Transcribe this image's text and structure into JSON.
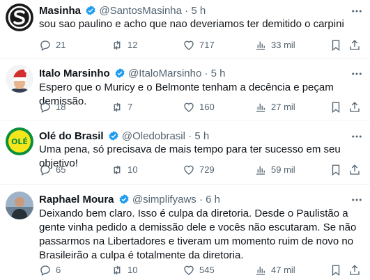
{
  "colors": {
    "text": "#0f1419",
    "secondary": "#536471",
    "verified": "#1d9bf0",
    "divider": "#eff3f4"
  },
  "tweets": [
    {
      "name": "Masinha",
      "handle": "@SantosMasinha",
      "separator": "·",
      "time": "5 h",
      "text": "sou sao paulino e acho que nao deveriamos ter demitido o carpini",
      "replies": "21",
      "retweets": "12",
      "likes": "717",
      "views": "33 mil",
      "avatar_icon": "masinha-logo-icon"
    },
    {
      "name": "Italo Marsinho",
      "handle": "@ItaloMarsinho",
      "separator": "·",
      "time": "5 h",
      "text": "Espero que o Muricy e o Belmonte tenham a decência e peçam demissão.",
      "replies": "18",
      "retweets": "7",
      "likes": "160",
      "views": "27 mil",
      "avatar_icon": "santa-hat-avatar-icon"
    },
    {
      "name": "Olé do Brasil",
      "handle": "@Oledobrasil",
      "separator": "·",
      "time": "5 h",
      "text": "Uma pena, só precisava de mais tempo para ter sucesso em seu objetivo!",
      "replies": "65",
      "retweets": "10",
      "likes": "729",
      "views": "59 mil",
      "avatar_icon": "ole-logo-icon",
      "avatar_logo_text": "OLÉ"
    },
    {
      "name": "Raphael Moura",
      "handle": "@simplifyaws",
      "separator": "·",
      "time": "6 h",
      "text": "Deixando bem claro. Isso é culpa da diretoria. Desde o Paulistão a gente vinha pedido a demissão dele e vocês não escutaram. Se não passarmos na Libertadores e tiveram um momento ruim de novo no Brasileirão a culpa é totalmente da diretoria.",
      "replies": "6",
      "retweets": "10",
      "likes": "545",
      "views": "47 mil",
      "avatar_icon": "person-photo-avatar-icon"
    }
  ]
}
